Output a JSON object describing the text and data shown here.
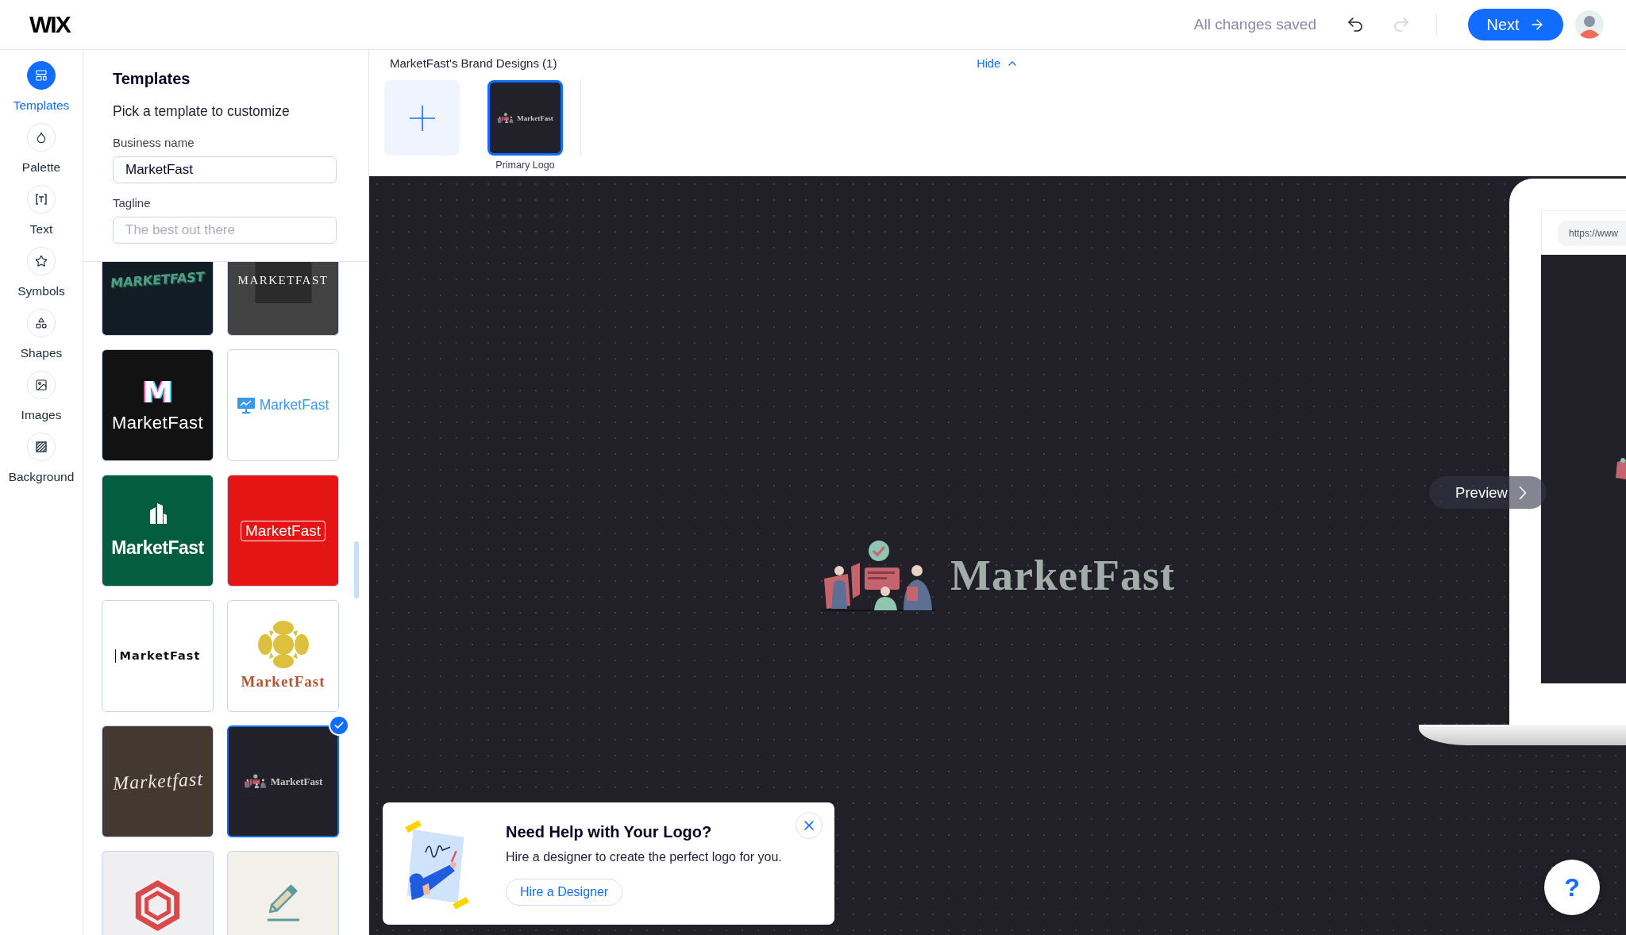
{
  "header": {
    "logo": "WIX",
    "save_status": "All changes saved",
    "undo": {
      "disabled": false
    },
    "redo": {
      "disabled": true
    },
    "next_button": "Next"
  },
  "rail": [
    {
      "kind": "templates",
      "label": "Templates",
      "selected": true
    },
    {
      "kind": "palette",
      "label": "Palette",
      "selected": false
    },
    {
      "kind": "text",
      "label": "Text",
      "selected": false
    },
    {
      "kind": "symbols",
      "label": "Symbols",
      "selected": false
    },
    {
      "kind": "shapes",
      "label": "Shapes",
      "selected": false
    },
    {
      "kind": "images",
      "label": "Images",
      "selected": false
    },
    {
      "kind": "background",
      "label": "Background",
      "selected": false
    }
  ],
  "panel": {
    "title": "Templates",
    "subtitle": "Pick a template to customize",
    "fields": [
      {
        "label": "Business name",
        "value": "MarketFast"
      },
      {
        "label": "Tagline",
        "placeholder": "The best out there"
      }
    ],
    "templates": [
      {
        "kind": "neon",
        "text": "MARKETFAST",
        "selected": false
      },
      {
        "kind": "serif",
        "text": "MARKETFAST",
        "selected": false
      },
      {
        "kind": "monogram",
        "initial": "M",
        "text": "MarketFast",
        "selected": false
      },
      {
        "kind": "monitor",
        "text": "MarketFast",
        "selected": false
      },
      {
        "kind": "building",
        "text": "MarketFast",
        "selected": false
      },
      {
        "kind": "boxed",
        "text": "MarketFast",
        "selected": false
      },
      {
        "kind": "handwritten",
        "text": "MarketFast",
        "selected": false
      },
      {
        "kind": "emblem",
        "text": "MarketFast",
        "selected": false
      },
      {
        "kind": "script",
        "text": "Marketfast",
        "selected": false
      },
      {
        "kind": "illustration",
        "text": "MarketFast",
        "selected": true
      },
      {
        "kind": "hexagon",
        "selected": false
      },
      {
        "kind": "pencil",
        "selected": false
      }
    ]
  },
  "brand_designs": {
    "title": "MarketFast's Brand Designs (1)",
    "hide_link": "Hide",
    "expanded": true,
    "designs": [
      {
        "logo_text": "MarketFast",
        "label": "Primary Logo",
        "selected": true
      }
    ]
  },
  "canvas": {
    "logo_text": "MarketFast",
    "preview_button": "Preview",
    "mockup_url": "https://www"
  },
  "help_card": {
    "title": "Need Help with Your Logo?",
    "text": "Hire a designer to create the perfect logo for you.",
    "button": "Hire a Designer"
  },
  "help_button": "?"
}
